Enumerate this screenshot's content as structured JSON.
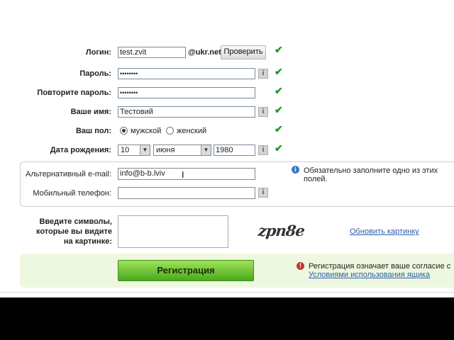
{
  "fields": {
    "login": {
      "label": "Логин:",
      "value": "test.zvit",
      "domain": "@ukr.net",
      "check_button": "Проверить"
    },
    "password": {
      "label": "Пароль:",
      "value": "••••••••"
    },
    "password_repeat": {
      "label": "Повторите пароль:",
      "value": "••••••••"
    },
    "name": {
      "label": "Ваше имя:",
      "value": "Тестовий"
    },
    "gender": {
      "label": "Ваш пол:",
      "options": [
        "мужской",
        "женский"
      ],
      "selected": "мужской"
    },
    "birth": {
      "label": "Дата рождения:",
      "day": "10",
      "month": "июня",
      "year": "1980"
    },
    "alt_email": {
      "label": "Альтернативный e-mail:",
      "value": "info@b-b.lviv"
    },
    "mobile": {
      "label": "Мобильный телефон:",
      "value": ""
    },
    "captcha": {
      "label": "Введите символы, которые вы видите на картинке:",
      "image_text": "zpn8e",
      "refresh_link": "Обновить картинку"
    }
  },
  "hints": {
    "contact_required": "Обязательно заполните одно из этих полей."
  },
  "register": {
    "button": "Регистрация",
    "notice": "Регистрация означает ваше согласие с",
    "terms_link": "Условиями использования ящика"
  },
  "icons": {
    "check": "check-icon",
    "info": "info-icon",
    "cursor": "text-cursor-icon"
  },
  "colors": {
    "check_green": "#1e9a1e",
    "band_green": "#eef7df",
    "button_green": "#4aa81d",
    "link_blue": "#2a5ea8"
  }
}
